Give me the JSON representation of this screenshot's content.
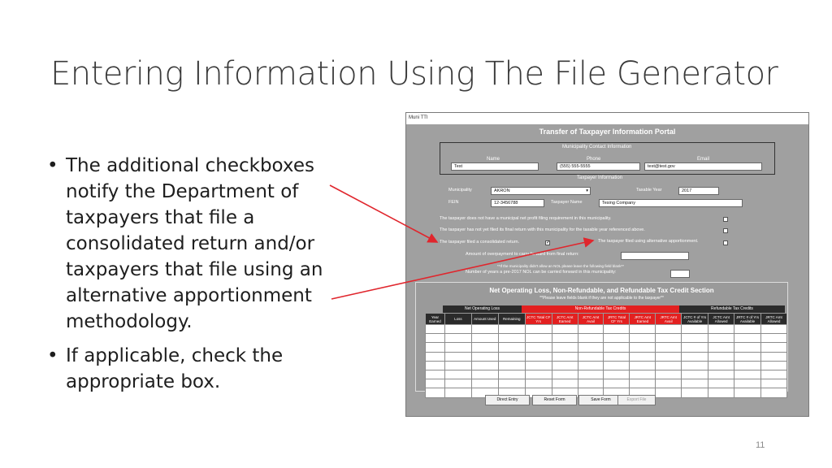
{
  "slide": {
    "title": "Entering Information Using The File Generator",
    "bullets": [
      "The additional checkboxes notify the Department of taxpayers that file a consolidated return and/or taxpayers that file using an alternative apportionment methodology.",
      "If applicable, check the appropriate box."
    ],
    "page_number": "11",
    "arrow_color": "#e0262d"
  },
  "window": {
    "title": "Muni TTI",
    "form_title": "Transfer of Taxpayer Information Portal",
    "contact": {
      "section_label": "Municipality Contact Information",
      "name_label": "Name",
      "phone_label": "Phone",
      "email_label": "Email",
      "name_value": "Test",
      "phone_value": "(555) 555-5555",
      "email_value": "test@test.gov"
    },
    "taxpayer": {
      "section_label": "Taxpayer Information",
      "municipality_label": "Municipality",
      "municipality_value": "AKRON",
      "taxable_year_label": "Taxable Year",
      "taxable_year_value": "2017",
      "fein_label": "FEIN",
      "fein_value": "12-3456788",
      "taxpayer_name_label": "Taxpayer Name",
      "taxpayer_name_value": "Tesing Company"
    },
    "checks": {
      "no_profit_requirement": "The taxpayer does not have a municipal net profit filing requirement in this municipality.",
      "no_final_return": "The taxpayer has not yet filed its final return with this municipality for the taxable year referenced above.",
      "consolidated": "The taxpayer filed a consolidated return.",
      "consolidated_checked": true,
      "alt_apportionment": "The taxpayer filed using alternative apportionment.",
      "alt_apportionment_checked": false,
      "overpayment_label": "Amount of overpayment to carry forward from final return:",
      "nol_note": "**If the municipality didn't allow an NOL please leave the following field blank**",
      "pre2017_label": "Number of years a pre-2017 NOL can be carried forward in this municipality:"
    },
    "nol": {
      "title": "Net Operating Loss, Non-Refundable, and Refundable Tax Credit Section",
      "note": "**Please leave fields blank if they are not applicable to the taxpayer**",
      "groups": [
        "Net Operating Loss",
        "Non-Refundable Tax Credits",
        "Refundable Tax Credits"
      ],
      "columns": [
        "Year Earned",
        "Loss",
        "Amount Used",
        "Remaining",
        "JCTC Total CF Yrs",
        "JCTC Amt Earned",
        "JCTC Amt Avail",
        "JRTC Total CF Yrs",
        "JRTC Amt Earned",
        "JRTC Amt Avail",
        "JCTC # of Yrs Available",
        "JCTC Amt Allowed",
        "JRTC # of Yrs Available",
        "JRTC Amt Allowed"
      ],
      "red_columns": [
        4,
        5,
        6,
        7,
        8,
        9
      ],
      "row_count": 8
    },
    "buttons": {
      "direct_entry": "Direct Entry",
      "reset_form": "Reset Form",
      "save_form": "Save Form",
      "export_file": "Export File"
    }
  }
}
